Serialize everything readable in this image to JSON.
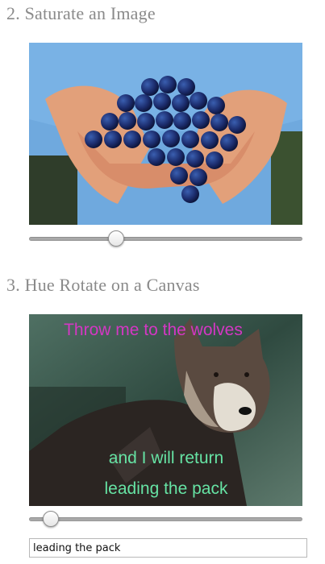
{
  "section1": {
    "title": "2. Saturate an Image",
    "slider_value": 0.32
  },
  "section2": {
    "title": "3. Hue Rotate on a Canvas",
    "slider_value": 0.08,
    "top_caption": "Throw me to the wolves",
    "bottom_caption_line1": "and I will return",
    "bottom_caption_line2": "leading the pack",
    "input_value": "leading the pack",
    "colors": {
      "top_caption": "#d437c4",
      "bottom_caption": "#66e3a4"
    }
  }
}
